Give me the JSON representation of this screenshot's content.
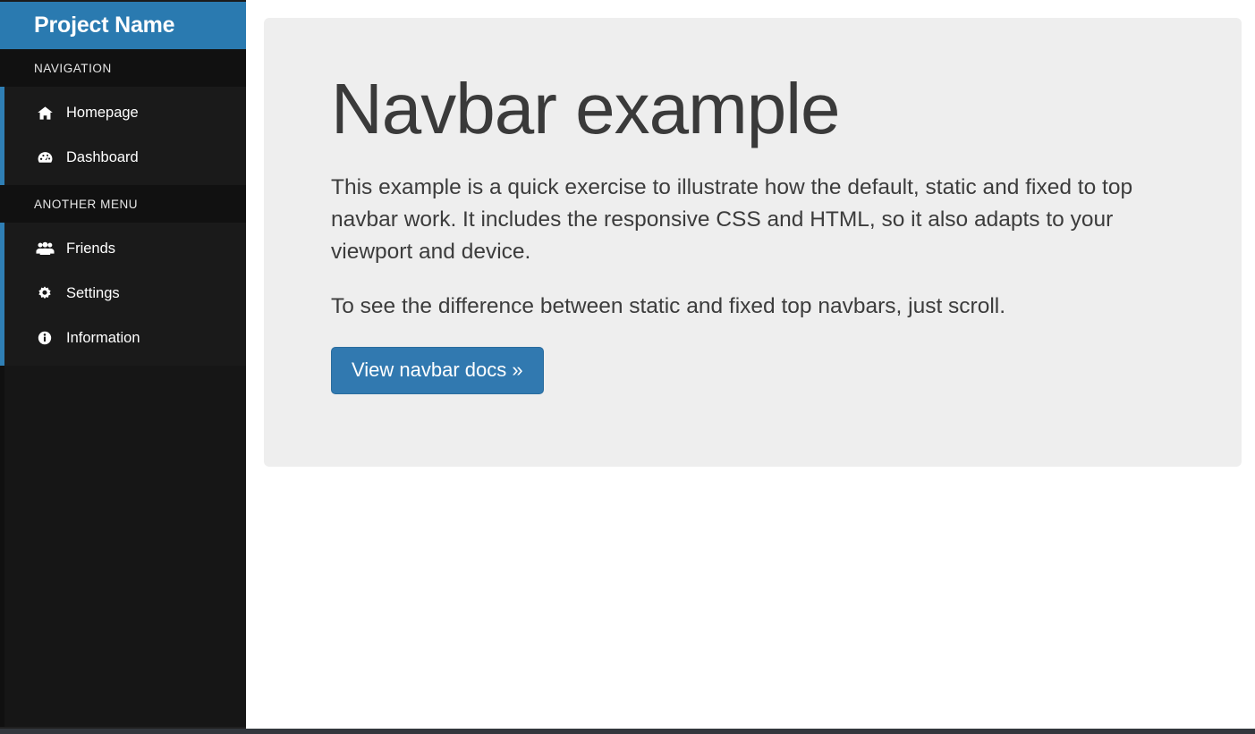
{
  "sidebar": {
    "brand": "Project Name",
    "sections": [
      {
        "header": "NAVIGATION",
        "items": [
          {
            "label": "Homepage",
            "icon": "home-icon"
          },
          {
            "label": "Dashboard",
            "icon": "dashboard-gauge-icon"
          }
        ]
      },
      {
        "header": "ANOTHER MENU",
        "items": [
          {
            "label": "Friends",
            "icon": "users-icon"
          },
          {
            "label": "Settings",
            "icon": "gear-icon"
          },
          {
            "label": "Information",
            "icon": "info-circle-icon"
          }
        ]
      }
    ]
  },
  "main": {
    "title": "Navbar example",
    "paragraph_1": "This example is a quick exercise to illustrate how the default, static and fixed to top navbar work. It includes the responsive CSS and HTML, so it also adapts to your viewport and device.",
    "paragraph_2": "To see the difference between static and fixed top navbars, just scroll.",
    "cta_label": "View navbar docs »"
  },
  "colors": {
    "brand_blue": "#2a7ab0",
    "accent_blue": "#2f7fb5",
    "button_blue": "#3179b0",
    "sidebar_dark": "#161616",
    "sidebar_section_dark": "#111111",
    "jumbotron_gray": "#eeeeee",
    "text_dark": "#3a3a3a"
  }
}
